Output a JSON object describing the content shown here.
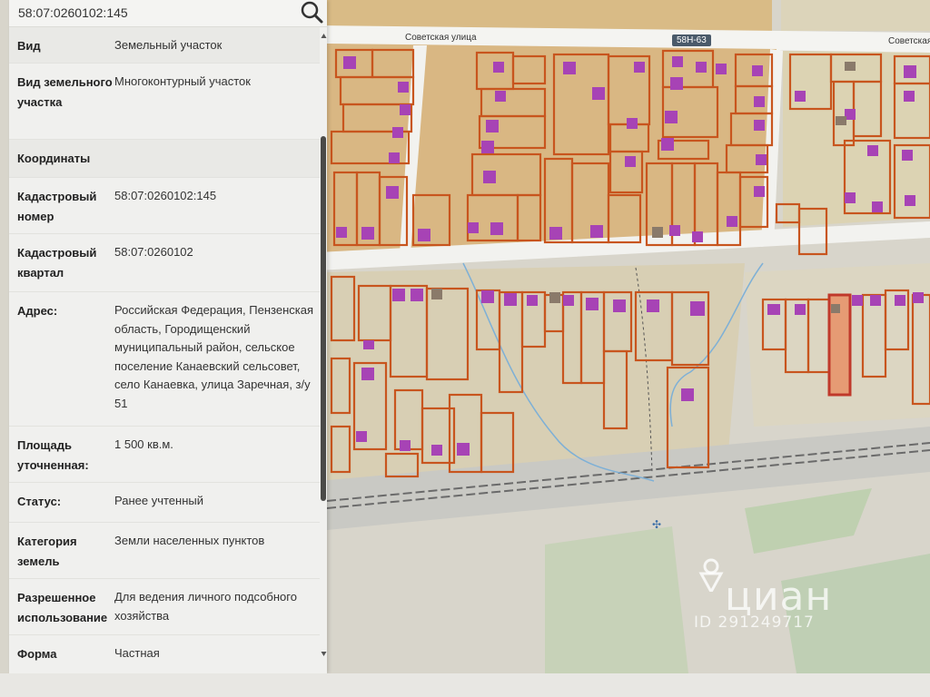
{
  "search": {
    "value": "58:07:0260102:145"
  },
  "map": {
    "street_labels": [
      "Советская улица",
      "Советская"
    ],
    "road_badge": "58Н-63"
  },
  "info": [
    {
      "label": "Вид",
      "value": "Земельный участок"
    },
    {
      "label": "Вид земельного участка",
      "value": "Многоконтурный участок"
    },
    {
      "label": "Координаты",
      "value": ""
    },
    {
      "label": "Кадастровый номер",
      "value": "58:07:0260102:145"
    },
    {
      "label": "Кадастровый квартал",
      "value": "58:07:0260102"
    },
    {
      "label": "Адрес:",
      "value": "Российская Федерация, Пензенская область, Городищенский муниципальный район, сельское поселение Канаевский сельсовет, село Канаевка, улица Заречная, з/у 51"
    },
    {
      "label": "Площадь уточненная:",
      "value": "1 500 кв.м."
    },
    {
      "label": "Статус:",
      "value": "Ранее учтенный"
    },
    {
      "label": "Категория земель",
      "value": "Земли населенных пунктов"
    },
    {
      "label": "Разрешенное использование",
      "value": "Для ведения личного подсобного хозяйства"
    },
    {
      "label": "Форма",
      "value": "Частная"
    }
  ],
  "watermark": {
    "brand": "циан",
    "id": "ID 291249717"
  },
  "colors": {
    "parcel_border": "#c8551e",
    "parcel_fill": "#d9b783",
    "building": "#a743b5",
    "road": "#f2f2ef",
    "panel_bg": "#f0f0ee"
  }
}
